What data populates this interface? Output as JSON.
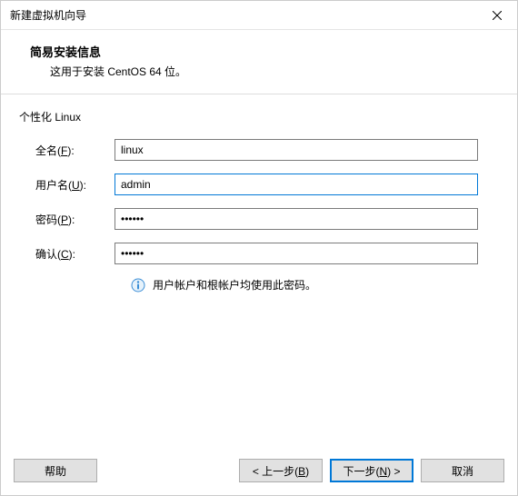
{
  "window": {
    "title": "新建虚拟机向导"
  },
  "header": {
    "title": "简易安装信息",
    "subtitle": "这用于安装 CentOS 64 位。"
  },
  "section": {
    "label": "个性化 Linux"
  },
  "form": {
    "fullname": {
      "label_prefix": "全名(",
      "label_key": "F",
      "label_suffix": "):",
      "value": "linux"
    },
    "username": {
      "label_prefix": "用户名(",
      "label_key": "U",
      "label_suffix": "):",
      "value": "admin"
    },
    "password": {
      "label_prefix": "密码(",
      "label_key": "P",
      "label_suffix": "):",
      "value": "••••••"
    },
    "confirm": {
      "label_prefix": "确认(",
      "label_key": "C",
      "label_suffix": "):",
      "value": "••••••"
    }
  },
  "info": {
    "text": "用户帐户和根帐户均使用此密码。"
  },
  "buttons": {
    "help": "帮助",
    "back_prefix": "< 上一步(",
    "back_key": "B",
    "back_suffix": ")",
    "next_prefix": "下一步(",
    "next_key": "N",
    "next_suffix": ") >",
    "cancel": "取消"
  }
}
